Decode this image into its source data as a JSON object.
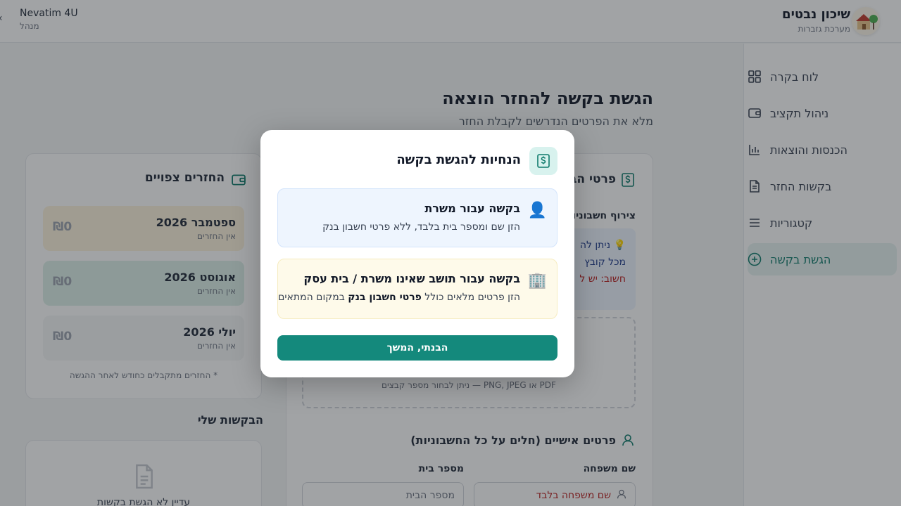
{
  "header": {
    "user_name": "Nevatim 4U",
    "user_role": "מנהל",
    "back_icon": "‹",
    "brand_title": "שיכון נבטים",
    "brand_subtitle": "מערכת גזברות"
  },
  "sidebar": {
    "items": [
      {
        "label": "לוח בקרה",
        "icon": "dashboard-icon"
      },
      {
        "label": "ניהול תקציב",
        "icon": "wallet-icon"
      },
      {
        "label": "הכנסות והוצאות",
        "icon": "bar-chart-icon"
      },
      {
        "label": "בקשות החזר",
        "icon": "document-icon"
      },
      {
        "label": "קטגוריות",
        "icon": "list-icon"
      },
      {
        "label": "הגשת בקשה",
        "icon": "plus-circle-icon",
        "active": true
      }
    ]
  },
  "main": {
    "title": "הגשת בקשה להחזר הוצאה",
    "subtitle": "מלא את הפרטים הנדרשים לקבלת החזר",
    "form_card_title": "פרטי הב",
    "attach_label": "צירוף חשבוניו",
    "tip_line1": "💡 ניתן לה",
    "tip_line2": "מכל קובץ",
    "tip_line3": "חשוב: יש ל",
    "upload_hint": "PDF או PNG, JPEG — ניתן לבחור מספר קבצים",
    "personal_section": "פרטים אישיים (חלים על כל החשבוניות)",
    "family_label": "שם משפחה",
    "house_label": "מספר בית",
    "family_placeholder": "שם משפחה בלבד",
    "house_placeholder": "מספר הבית"
  },
  "refunds": {
    "title": "החזרים צפויים",
    "rows": [
      {
        "month": "ספטמבר 2026",
        "status": "אין החזרים",
        "amount": "₪0"
      },
      {
        "month": "אוגוסט 2026",
        "status": "אין החזרים",
        "amount": "₪0"
      },
      {
        "month": "יולי 2026",
        "status": "אין החזרים",
        "amount": "₪0"
      }
    ],
    "note": "* החזרים מתקבלים כחודש לאחר ההגשה"
  },
  "my_requests": {
    "title": "הבקשות שלי",
    "empty": "עדיין לא הגשת בקשות"
  },
  "modal": {
    "title": "הנחיות להגשת בקשה",
    "option1": {
      "emoji": "👤",
      "title": "בקשה עבור משרת",
      "text": "הזן שם ומספר בית בלבד, ללא פרטי חשבון בנק"
    },
    "option2": {
      "emoji": "🏢",
      "title": "בקשה עבור תושב שאינו משרת / בית עסק",
      "text_before": "הזן פרטים מלאים כולל ",
      "text_bold": "פרטי חשבון בנק",
      "text_after": " במקום המתאים"
    },
    "confirm_label": "הבנתי, המשך"
  },
  "colors": {
    "accent": "#14897c",
    "active_bg": "#e7f3f1",
    "option1_bg": "#eef5fe",
    "option2_bg": "#fefaea"
  }
}
